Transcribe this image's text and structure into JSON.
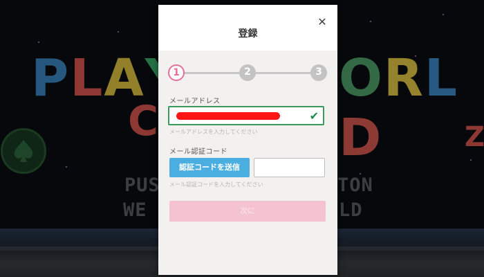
{
  "background": {
    "title_letters_left": [
      "P",
      "L",
      "A",
      "Y"
    ],
    "title_letters_right": [
      "O",
      "R",
      "L",
      "D"
    ],
    "subtitle_left": "PUS",
    "subtitle_right": "TON",
    "subtitle2_left": "WE",
    "subtitle2_right": "LD"
  },
  "modal": {
    "title": "登録",
    "close_icon": "close-icon",
    "steps": [
      "1",
      "2",
      "3"
    ],
    "current_step": 1,
    "email_label": "メールアドレス",
    "email_hint": "メールアドレスを入力してください",
    "email_value": "",
    "code_label": "メール認証コード",
    "send_code_label": "認証コードを送信",
    "code_value": "",
    "code_hint": "メール認証コードを入力してください",
    "next_label": "次に"
  },
  "colors": {
    "accent_pink": "#e86e98",
    "send_blue": "#4aaee0",
    "valid_green": "#3a9a5a",
    "next_disabled": "#f5c2d2"
  }
}
